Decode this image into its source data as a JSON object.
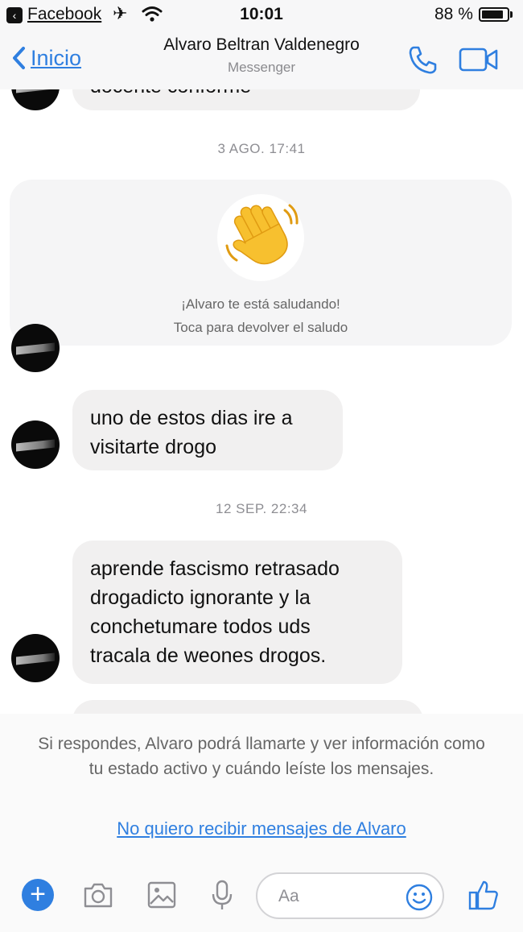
{
  "status_bar": {
    "back_app": "Facebook",
    "time": "10:01",
    "battery": "88 %",
    "battery_level": 0.88
  },
  "nav": {
    "back_label": "Inicio",
    "title": "Alvaro Beltran Valdenegro",
    "subtitle": "Messenger",
    "call_icon": "phone-icon",
    "video_icon": "video-icon"
  },
  "chat": {
    "top_partial_text": "docente conforme",
    "timestamps": [
      "3 AGO. 17:41",
      "12 SEP. 22:34"
    ],
    "wave_card": {
      "line1": "¡Alvaro te está saludando!",
      "line2": "Toca para devolver el saludo"
    },
    "messages": [
      {
        "lines": [
          "uno de estos dias ire a",
          "visitarte drogo"
        ]
      },
      {
        "lines": [
          "aprende fascismo retrasado",
          "drogadicto ignorante y la",
          "conchetumare todos uds",
          "tracala de weones drogos."
        ]
      }
    ]
  },
  "notice": {
    "text": "Si respondes, Alvaro podrá llamarte y ver información como tu estado activo y cuándo leíste los mensajes.",
    "link": "No quiero recibir mensajes de Alvaro"
  },
  "composer": {
    "placeholder": "Aa",
    "icons": [
      "plus-icon",
      "camera-icon",
      "image-icon",
      "microphone-icon",
      "emoji-icon",
      "thumbs-up-icon"
    ]
  },
  "colors": {
    "accent": "#2f7fe0",
    "bubble": "#f1f0f0",
    "wave": "#f7c02f"
  }
}
